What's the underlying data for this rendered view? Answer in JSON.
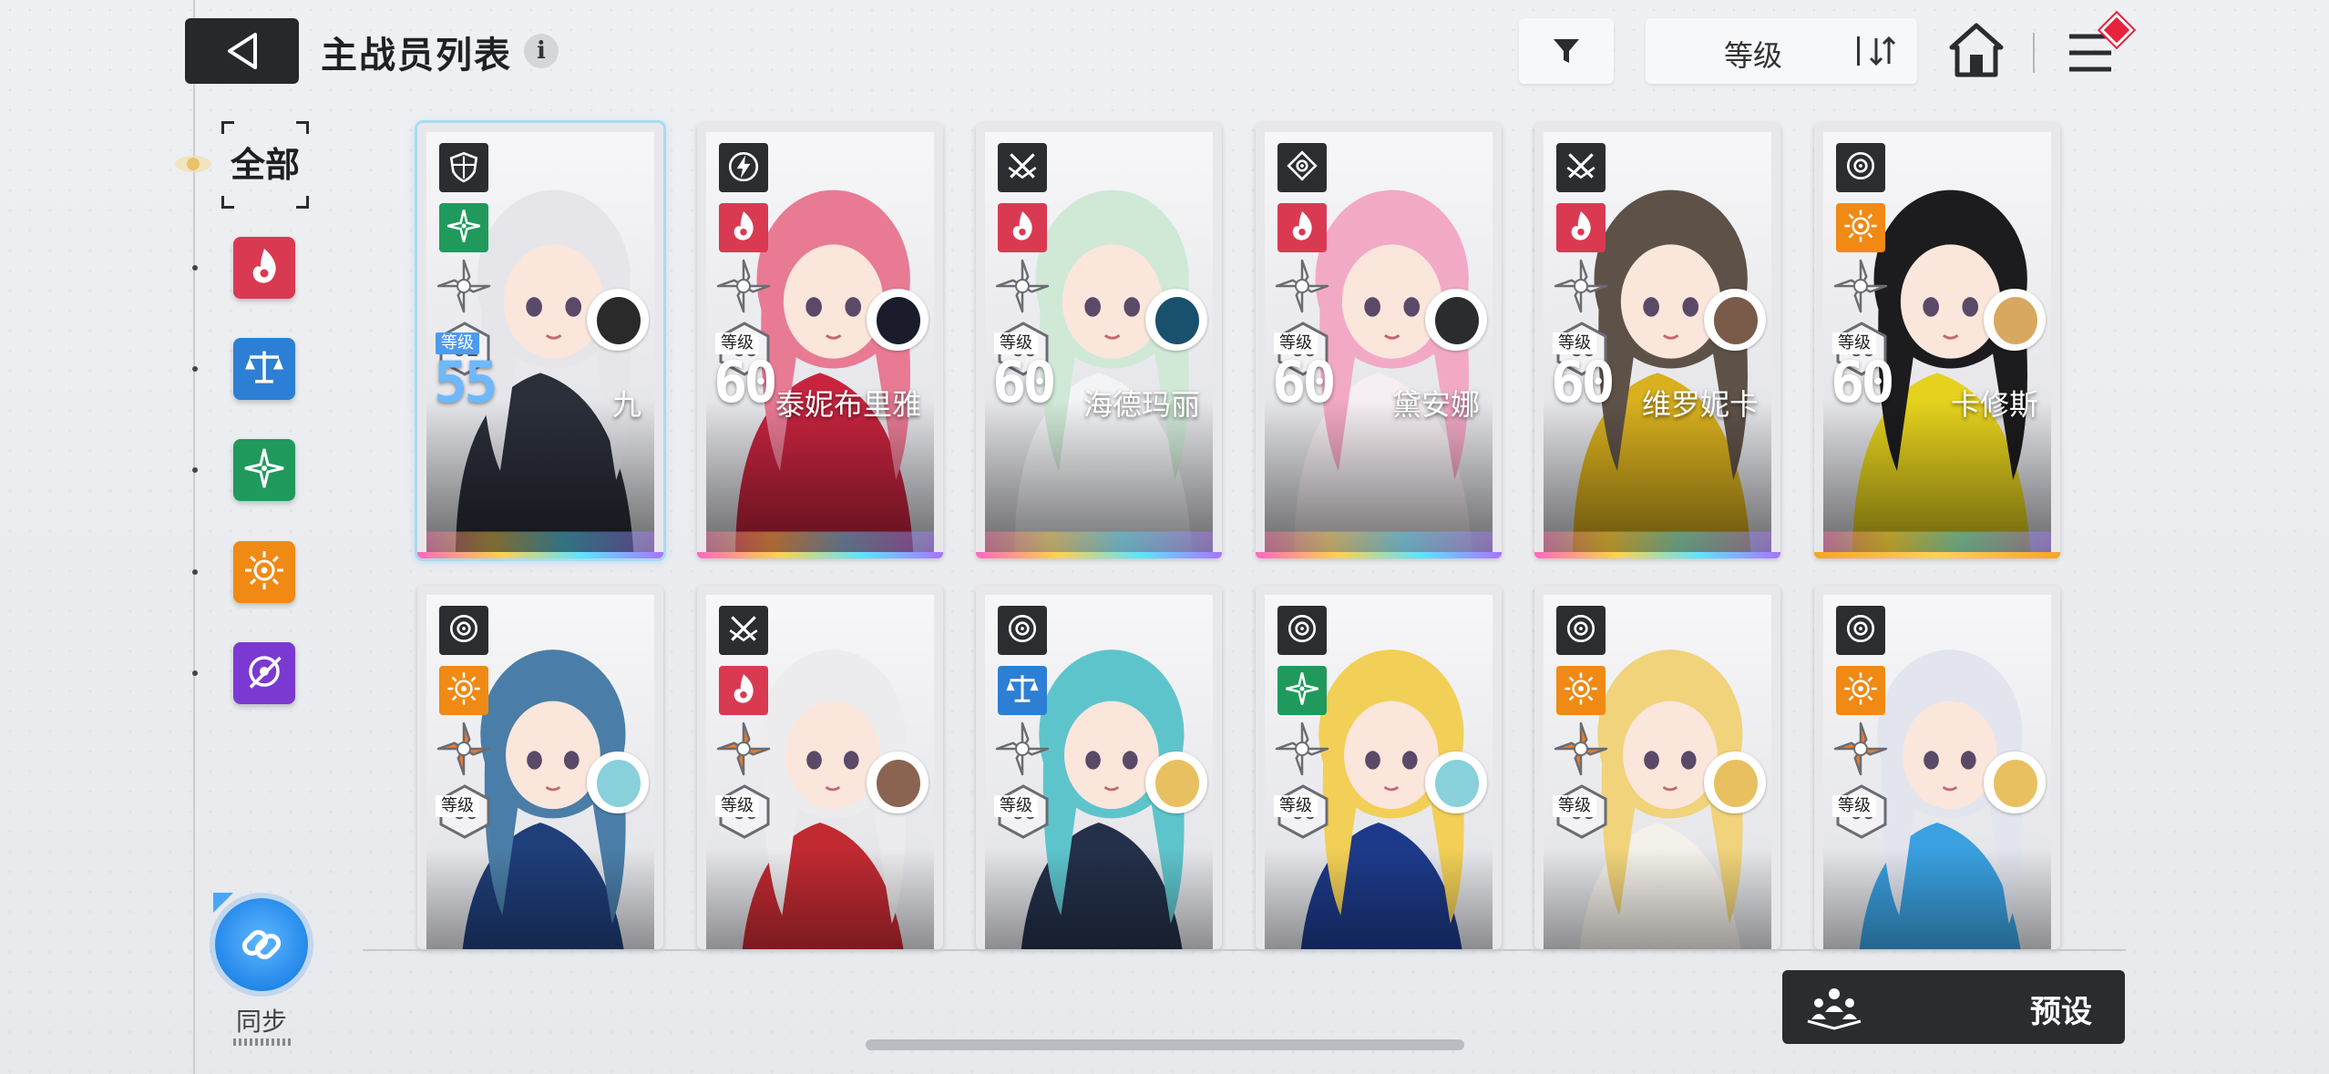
{
  "header": {
    "title": "主战员列表",
    "info_glyph": "i",
    "sort_label": "等级"
  },
  "sidebar": {
    "all_label": "全部",
    "elements": [
      {
        "name": "fire",
        "color": "#d93a52"
      },
      {
        "name": "balance",
        "color": "#2c7fd4"
      },
      {
        "name": "wind",
        "color": "#1f9a5c"
      },
      {
        "name": "light",
        "color": "#f08a14"
      },
      {
        "name": "void",
        "color": "#7a3ad2"
      }
    ],
    "sync_label": "同步"
  },
  "cards": [
    {
      "name": "九",
      "level_label": "等级",
      "level": "55",
      "rank": "01",
      "class_icon": "shield-icon",
      "element": "wind",
      "selected": true,
      "hair": "#e6e6ea",
      "accent": "#2b2f3a",
      "avatar_hair": "#2a2a2a"
    },
    {
      "name": "泰妮布里雅",
      "level_label": "等级",
      "level": "60",
      "rank": "00",
      "class_icon": "lightning-icon",
      "element": "fire",
      "selected": false,
      "hair": "#e87a94",
      "accent": "#c8243f",
      "avatar_hair": "#1a1c2c"
    },
    {
      "name": "海德玛丽",
      "level_label": "等级",
      "level": "60",
      "rank": "00",
      "class_icon": "crossed-swords-icon",
      "element": "fire",
      "selected": false,
      "hair": "#cfe9d6",
      "accent": "#f3f4f6",
      "avatar_hair": "#18506e"
    },
    {
      "name": "黛安娜",
      "level_label": "等级",
      "level": "60",
      "rank": "00",
      "class_icon": "target-icon",
      "element": "fire",
      "selected": false,
      "hair": "#f2a9c6",
      "accent": "#f5eef2",
      "avatar_hair": "#2a2c30"
    },
    {
      "name": "维罗妮卡",
      "level_label": "等级",
      "level": "60",
      "rank": "00",
      "class_icon": "crossed-swords-icon",
      "element": "fire",
      "selected": false,
      "hair": "#5e5248",
      "accent": "#d9b01e",
      "avatar_hair": "#7a5a48"
    },
    {
      "name": "卡修斯",
      "level_label": "等级",
      "level": "60",
      "rank": "00",
      "class_icon": "scope-icon",
      "element": "light",
      "selected": false,
      "hair": "#1c1c1e",
      "accent": "#e6d21e",
      "avatar_hair": "#d8a860"
    },
    {
      "name": "",
      "level_label": "等级",
      "level": "",
      "rank": "00",
      "class_icon": "scope-icon",
      "element": "light",
      "selected": false,
      "hair": "#4a7ea8",
      "accent": "#1f3e7a",
      "avatar_hair": "#88d0da"
    },
    {
      "name": "",
      "level_label": "等级",
      "level": "",
      "rank": "00",
      "class_icon": "crossed-swords-icon",
      "element": "fire",
      "selected": false,
      "hair": "#ececee",
      "accent": "#c22a32",
      "avatar_hair": "#8a6450"
    },
    {
      "name": "",
      "level_label": "等级",
      "level": "",
      "rank": "00",
      "class_icon": "scope-icon",
      "element": "balance",
      "selected": false,
      "hair": "#5ec4cc",
      "accent": "#24304a",
      "avatar_hair": "#e8c060"
    },
    {
      "name": "",
      "level_label": "等级",
      "level": "",
      "rank": "00",
      "class_icon": "scope-icon",
      "element": "wind",
      "selected": false,
      "hair": "#f2cf56",
      "accent": "#1d3a8a",
      "avatar_hair": "#88d0da"
    },
    {
      "name": "",
      "level_label": "等级",
      "level": "",
      "rank": "00",
      "class_icon": "scope-icon",
      "element": "light",
      "selected": false,
      "hair": "#f0d37a",
      "accent": "#f4f0ea",
      "avatar_hair": "#e8c060"
    },
    {
      "name": "",
      "level_label": "等级",
      "level": "",
      "rank": "00",
      "class_icon": "scope-icon",
      "element": "light",
      "selected": false,
      "hair": "#e2e4ee",
      "accent": "#3aa0e0",
      "avatar_hair": "#e8c060"
    }
  ],
  "preset": {
    "label": "预设"
  }
}
